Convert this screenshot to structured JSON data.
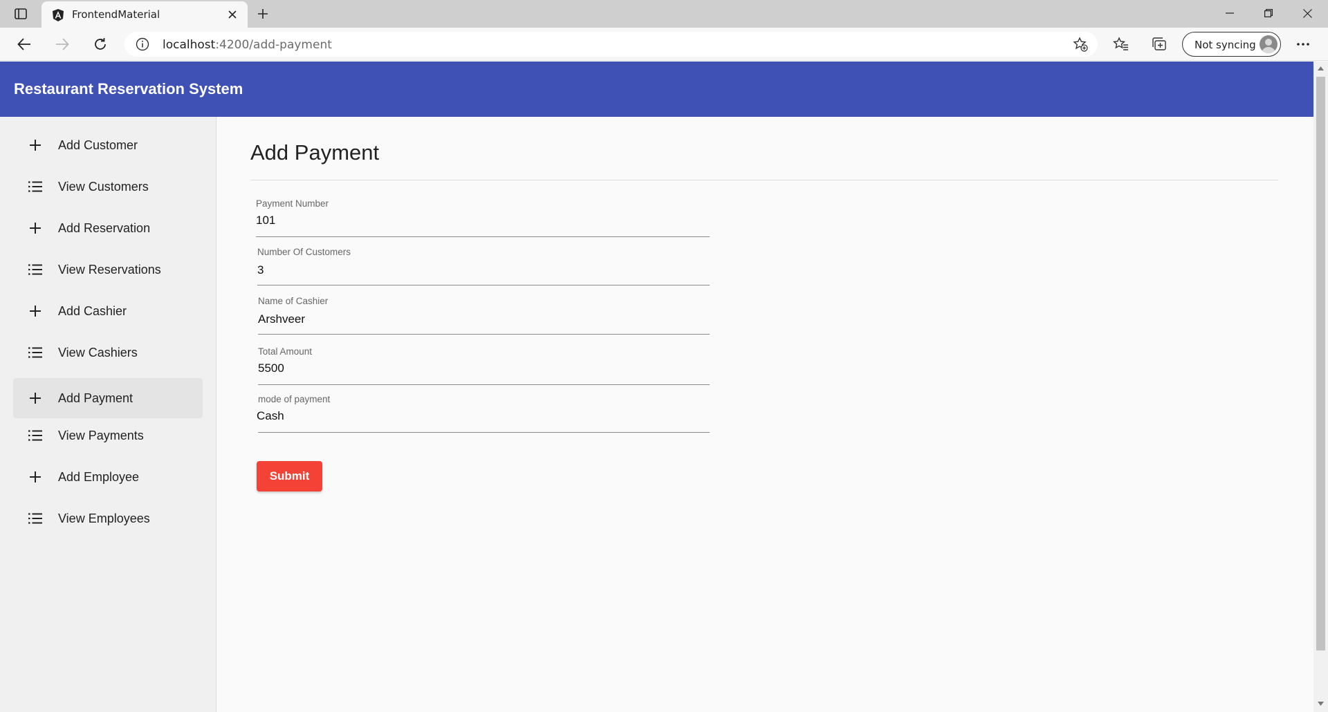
{
  "browser": {
    "tab_title": "FrontendMaterial",
    "url_host": "localhost",
    "url_path": ":4200/add-payment",
    "sync_label": "Not syncing"
  },
  "app": {
    "title": "Restaurant Reservation System"
  },
  "sidebar": {
    "items": [
      {
        "label": "Add Customer",
        "icon": "plus-icon"
      },
      {
        "label": "View Customers",
        "icon": "list-icon"
      },
      {
        "label": "Add Reservation",
        "icon": "plus-icon"
      },
      {
        "label": "View Reservations",
        "icon": "list-icon"
      },
      {
        "label": "Add Cashier",
        "icon": "plus-icon"
      },
      {
        "label": "View Cashiers",
        "icon": "list-icon"
      },
      {
        "label": "Add Payment",
        "icon": "plus-icon",
        "active": true
      },
      {
        "label": "View Payments",
        "icon": "list-icon"
      },
      {
        "label": "Add Employee",
        "icon": "plus-icon"
      },
      {
        "label": "View Employees",
        "icon": "list-icon"
      }
    ]
  },
  "form": {
    "title": "Add Payment",
    "fields": [
      {
        "label": "Payment Number",
        "value": "101"
      },
      {
        "label": "Number Of Customers",
        "value": "3"
      },
      {
        "label": "Name of Cashier",
        "value": "Arshveer"
      },
      {
        "label": "Total Amount",
        "value": "5500"
      },
      {
        "label": "mode of payment",
        "value": "Cash"
      }
    ],
    "submit_label": "Submit"
  },
  "colors": {
    "header": "#3f51b5",
    "submit": "#f44336",
    "active_nav": "#e4e4e4"
  }
}
